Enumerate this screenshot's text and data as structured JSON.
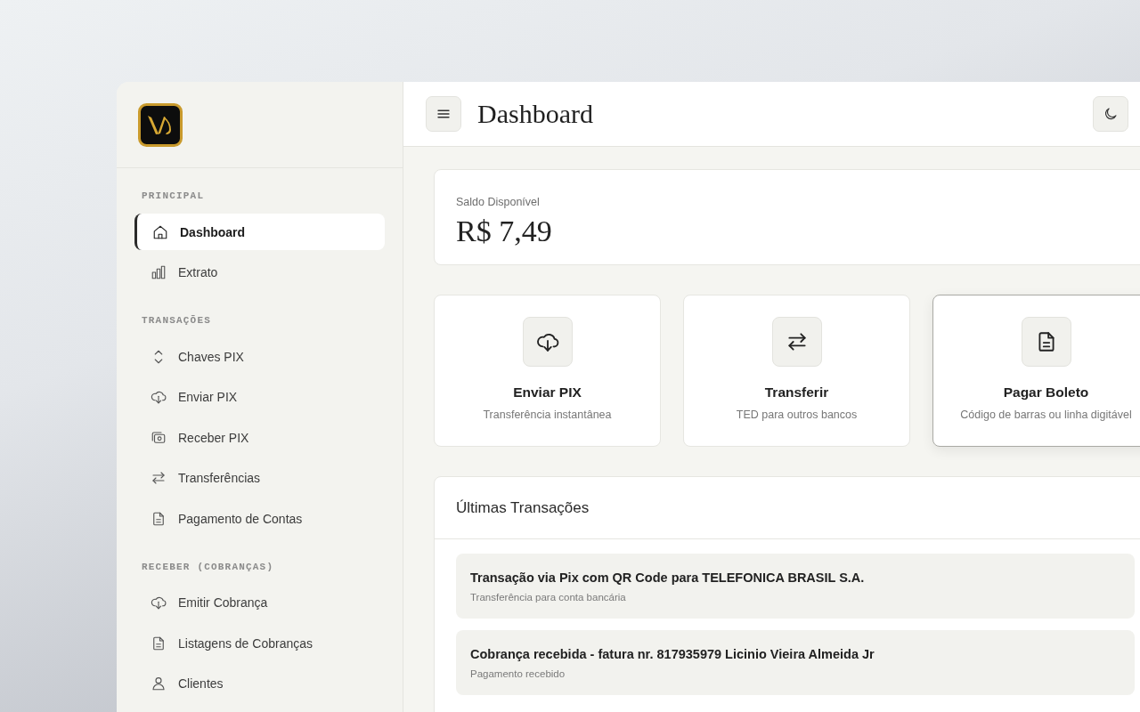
{
  "sidebar": {
    "sections": [
      {
        "title": "PRINCIPAL",
        "items": [
          {
            "label": "Dashboard",
            "selected": true
          },
          {
            "label": "Extrato",
            "selected": false
          }
        ]
      },
      {
        "title": "TRANSAÇÕES",
        "items": [
          {
            "label": "Chaves PIX",
            "selected": false
          },
          {
            "label": "Enviar PIX",
            "selected": false
          },
          {
            "label": "Receber PIX",
            "selected": false
          },
          {
            "label": "Transferências",
            "selected": false
          },
          {
            "label": "Pagamento de Contas",
            "selected": false
          }
        ]
      },
      {
        "title": "RECEBER (COBRANÇAS)",
        "items": [
          {
            "label": "Emitir Cobrança",
            "selected": false
          },
          {
            "label": "Listagens de Cobranças",
            "selected": false
          },
          {
            "label": "Clientes",
            "selected": false
          }
        ]
      }
    ]
  },
  "header": {
    "title": "Dashboard"
  },
  "balance": {
    "label": "Saldo Disponível",
    "amount": "R$ 7,49"
  },
  "actions": [
    {
      "title": "Enviar PIX",
      "subtitle": "Transferência instantânea",
      "highlighted": false
    },
    {
      "title": "Transferir",
      "subtitle": "TED para outros bancos",
      "highlighted": false
    },
    {
      "title": "Pagar Boleto",
      "subtitle": "Código de barras ou linha digitável",
      "highlighted": true
    }
  ],
  "transactions": {
    "title": "Últimas Transações",
    "items": [
      {
        "title": "Transação via Pix com QR Code para TELEFONICA BRASIL S.A.",
        "subtitle": "Transferência para conta bancária"
      },
      {
        "title": "Cobrança recebida - fatura nr. 817935979 Licinio Vieira Almeida Jr",
        "subtitle": "Pagamento recebido"
      }
    ]
  }
}
